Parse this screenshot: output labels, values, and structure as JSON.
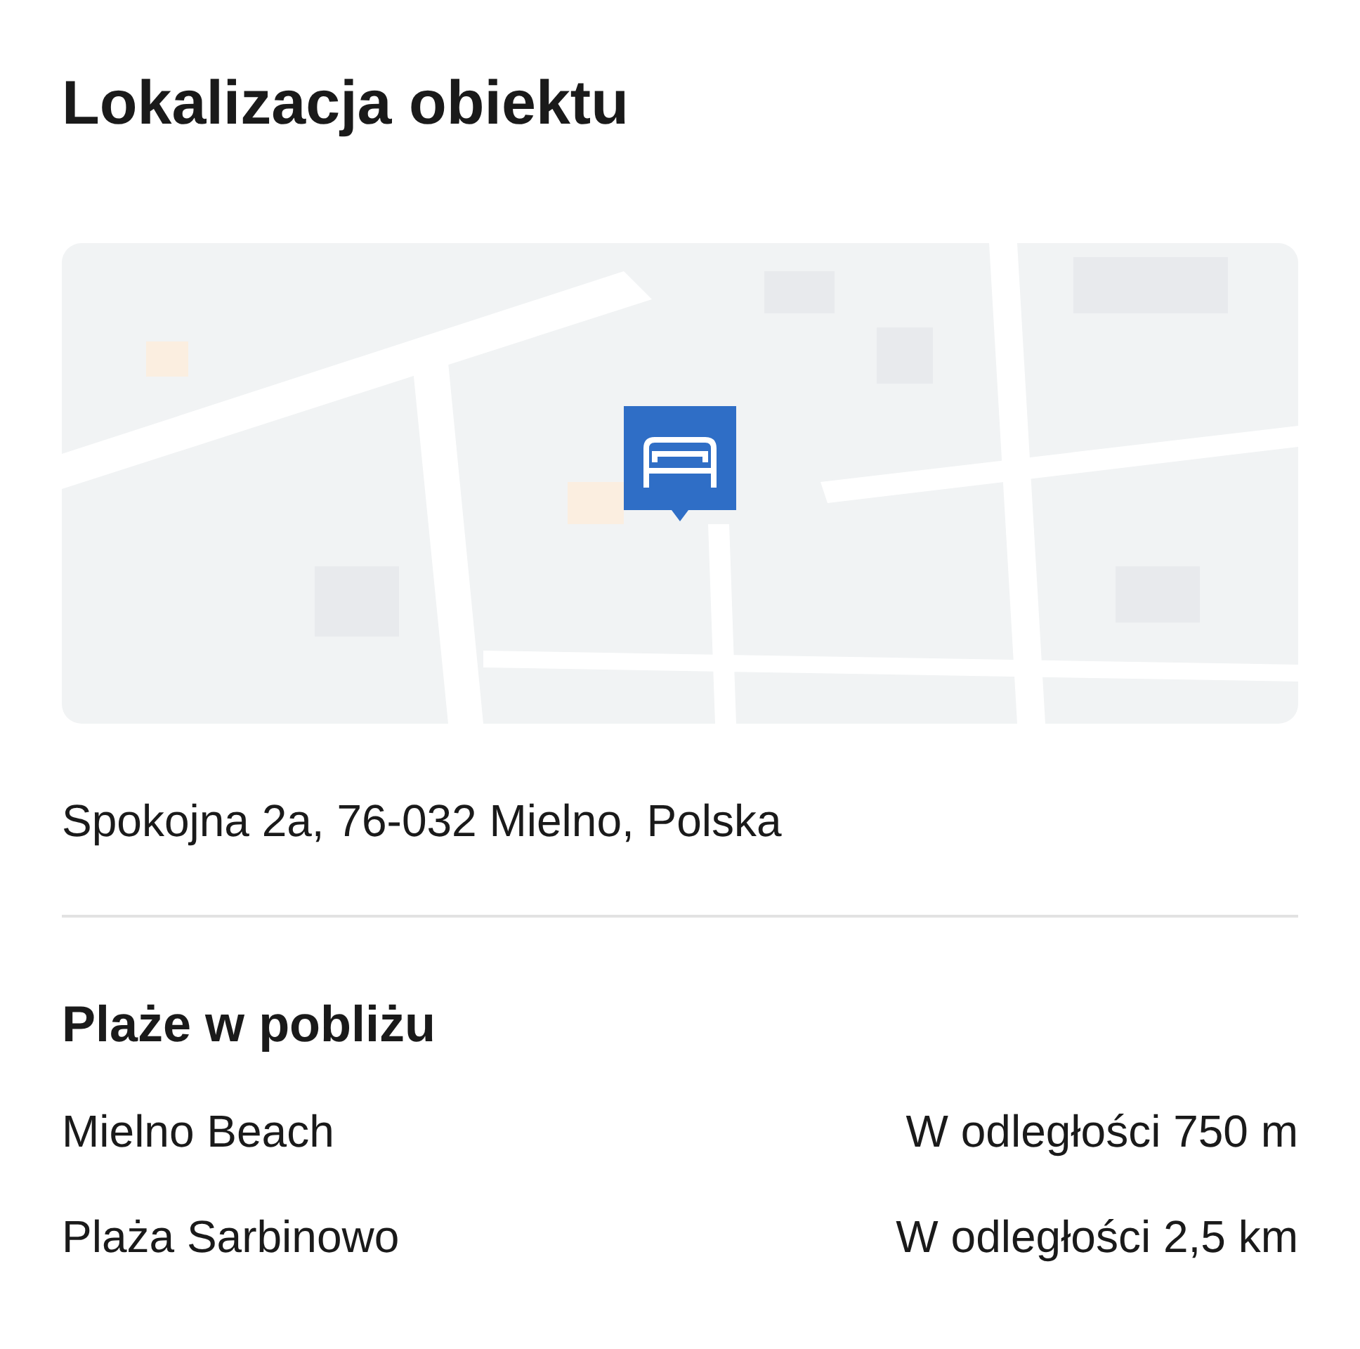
{
  "title": "Lokalizacja obiektu",
  "address": "Spokojna 2a, 76-032 Mielno, Polska",
  "beaches": {
    "heading": "Plaże w pobliżu",
    "items": [
      {
        "name": "Mielno Beach",
        "distance": "W odległości 750 m"
      },
      {
        "name": "Plaża Sarbinowo",
        "distance": "W odległości 2,5 km"
      }
    ]
  }
}
